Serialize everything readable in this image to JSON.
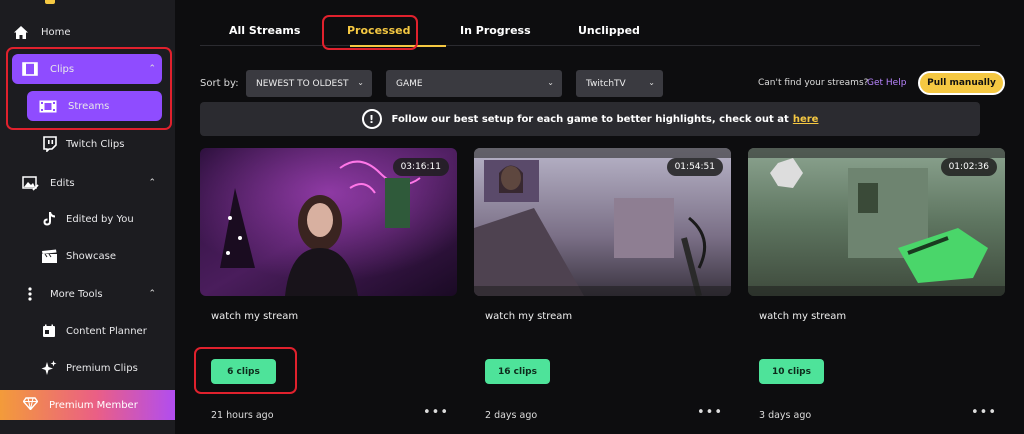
{
  "sidebar": {
    "items": [
      {
        "label": "Home",
        "icon": "home-icon"
      },
      {
        "label": "Clips",
        "icon": "film-icon"
      },
      {
        "label": "Streams",
        "icon": "film-strip-icon"
      },
      {
        "label": "Twitch Clips",
        "icon": "twitch-icon"
      },
      {
        "label": "Edits",
        "icon": "image-edit-icon"
      },
      {
        "label": "Edited by You",
        "icon": "tiktok-icon"
      },
      {
        "label": "Showcase",
        "icon": "clapper-icon"
      },
      {
        "label": "More Tools",
        "icon": "vertical-dots-icon"
      },
      {
        "label": "Content Planner",
        "icon": "calendar-icon"
      },
      {
        "label": "Premium Clips",
        "icon": "sparkle-icon"
      }
    ],
    "premium_label": "Premium Member"
  },
  "tabs": [
    {
      "label": "All Streams"
    },
    {
      "label": "Processed"
    },
    {
      "label": "In Progress"
    },
    {
      "label": "Unclipped"
    }
  ],
  "sort": {
    "label": "Sort by:",
    "order_value": "NEWEST TO OLDEST",
    "game_value": "GAME",
    "platform_value": "TwitchTV"
  },
  "help": {
    "text": "Can't find your streams?",
    "link": "Get Help",
    "pull_button": "Pull manually"
  },
  "banner": {
    "text": "Follow our best setup for each game to better highlights, check out at",
    "link": "here"
  },
  "cards": [
    {
      "duration": "03:16:11",
      "title": "watch my stream",
      "clips": "6 clips",
      "ago": "21 hours ago"
    },
    {
      "duration": "01:54:51",
      "title": "watch my stream",
      "clips": "16 clips",
      "ago": "2 days ago"
    },
    {
      "duration": "01:02:36",
      "title": "watch my stream",
      "clips": "10 clips",
      "ago": "3 days ago"
    }
  ],
  "colors": {
    "accent_purple": "#8f4cff",
    "accent_yellow": "#f5c842",
    "clips_green": "#4ee39a",
    "highlight_red": "#e0212d"
  }
}
